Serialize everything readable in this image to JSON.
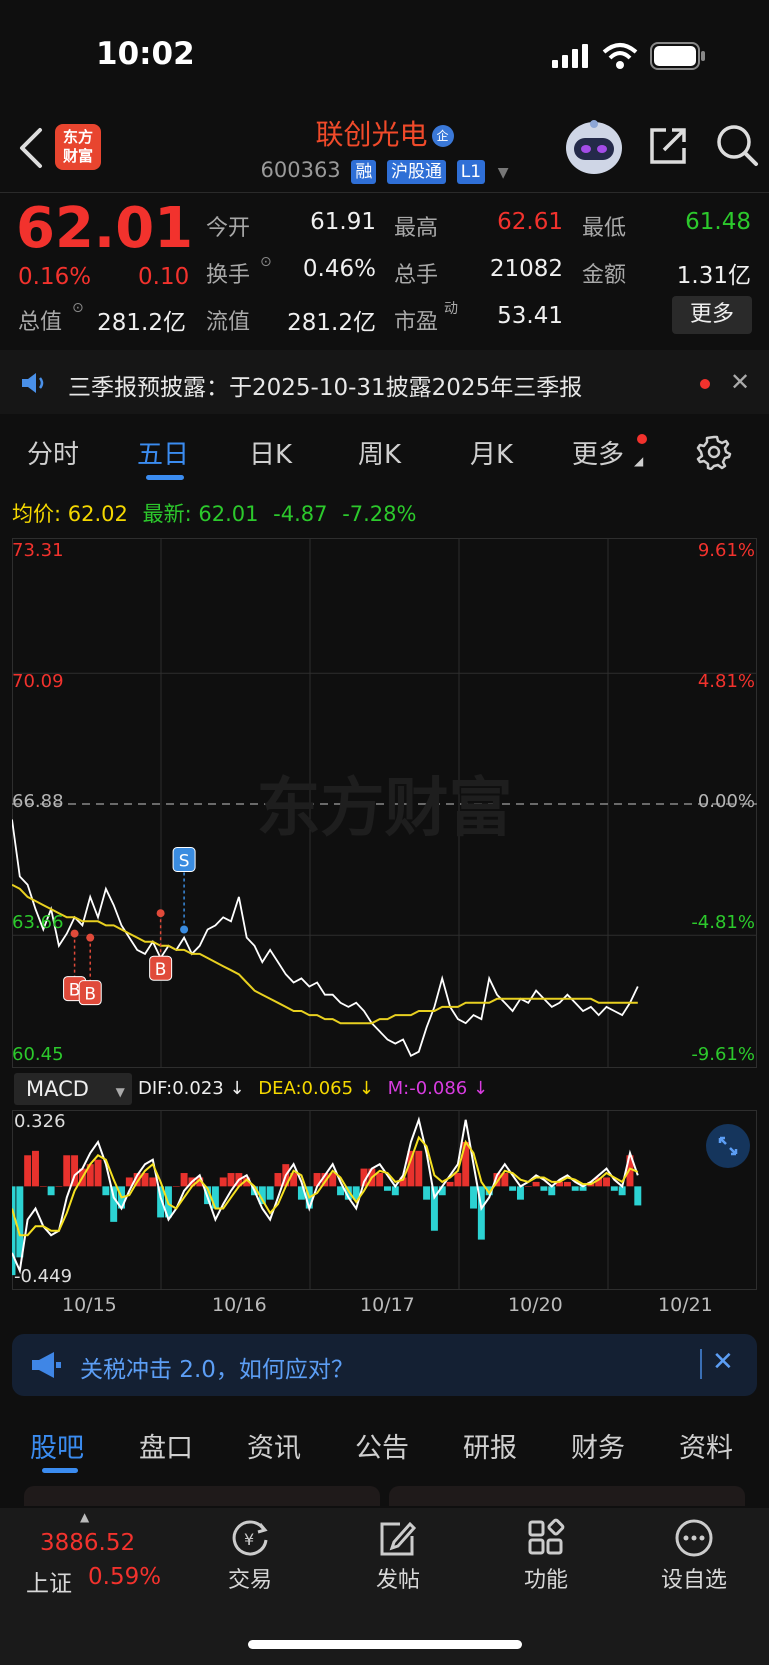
{
  "status_bar": {
    "time": "10:02"
  },
  "header": {
    "logo_line1": "东方",
    "logo_line2": "财富",
    "stock_name": "联创光电",
    "name_badge": "企",
    "stock_code": "600363",
    "tags": [
      "融",
      "沪股通",
      "L1"
    ]
  },
  "quote": {
    "price": "62.01",
    "change_pct": "0.16%",
    "change": "0.10",
    "fields": [
      {
        "label": "今开",
        "value": "61.91",
        "color": "white"
      },
      {
        "label": "最高",
        "value": "62.61",
        "color": "red"
      },
      {
        "label": "最低",
        "value": "61.48",
        "color": "green"
      },
      {
        "label": "换手",
        "value": "0.46%",
        "color": "white"
      },
      {
        "label": "总手",
        "value": "21082",
        "color": "white"
      },
      {
        "label": "金额",
        "value": "1.31亿",
        "color": "white"
      },
      {
        "label": "总值",
        "value": "281.2亿",
        "color": "white"
      },
      {
        "label": "流值",
        "value": "281.2亿",
        "color": "white"
      },
      {
        "label": "市盈",
        "value": "53.41",
        "color": "white"
      }
    ],
    "pe_superscript": "动",
    "more_label": "更多"
  },
  "notice": {
    "text": "三季报预披露：于2025-10-31披露2025年三季报"
  },
  "period_tabs": [
    "分时",
    "五日",
    "日K",
    "周K",
    "月K",
    "更多"
  ],
  "active_period_tab": "五日",
  "avg_row": {
    "avg_label": "均价:",
    "avg_value": "62.02",
    "latest_label": "最新:",
    "latest_value": "62.01",
    "latest_change": "-4.87",
    "latest_pct": "-7.28%"
  },
  "chart_data": {
    "type": "line",
    "y_ticks_left": [
      "73.31",
      "70.09",
      "66.88",
      "63.66",
      "60.45"
    ],
    "y_ticks_right": [
      "9.61%",
      "4.81%",
      "0.00%",
      "-4.81%",
      "-9.61%"
    ],
    "ylim": [
      60.45,
      73.31
    ],
    "reference_price": 66.88,
    "x_dates": [
      "10/15",
      "10/16",
      "10/17",
      "10/20",
      "10/21"
    ],
    "watermark": "东方财富",
    "series": [
      {
        "values": [
          66.5,
          65.1,
          64.9,
          64.3,
          63.8,
          64.3,
          63.4,
          63.7,
          64.1,
          63.9,
          64.6,
          64.1,
          64.8,
          64.4,
          63.9,
          63.6,
          63.3,
          63.2,
          63.5,
          63.1,
          63.4,
          63.3,
          63.6,
          63.2,
          63.4,
          63.8,
          63.9,
          64.1,
          64.0,
          64.6,
          63.6,
          63.4,
          63.0,
          63.3,
          63.0,
          62.7,
          62.5,
          62.6,
          62.4,
          62.5,
          62.2,
          62.2,
          62.0,
          61.9,
          62.0,
          61.8,
          61.5,
          61.3,
          61.1,
          61.0,
          61.1,
          60.7,
          60.8,
          61.4,
          61.9,
          62.6,
          61.9,
          61.6,
          61.5,
          61.7,
          61.6,
          62.6,
          62.2,
          62.0,
          61.8,
          62.1,
          62.0,
          62.3,
          62.1,
          61.9,
          62.0,
          62.2,
          62.0,
          61.8,
          61.9,
          61.7,
          61.9,
          61.8,
          61.7,
          62.0,
          62.4
        ]
      },
      {
        "values": [
          64.9,
          64.8,
          64.6,
          64.5,
          64.4,
          64.3,
          64.2,
          64.1,
          64.1,
          64.0,
          64.0,
          64.0,
          63.9,
          63.9,
          63.8,
          63.7,
          63.6,
          63.5,
          63.5,
          63.4,
          63.4,
          63.3,
          63.3,
          63.2,
          63.2,
          63.1,
          63.0,
          62.9,
          62.8,
          62.7,
          62.5,
          62.3,
          62.2,
          62.1,
          62.0,
          61.9,
          61.8,
          61.8,
          61.7,
          61.7,
          61.6,
          61.6,
          61.5,
          61.5,
          61.5,
          61.5,
          61.5,
          61.6,
          61.6,
          61.7,
          61.7,
          61.7,
          61.8,
          61.8,
          61.8,
          61.9,
          61.9,
          61.9,
          62.0,
          62.0,
          62.0,
          62.0,
          62.1,
          62.1,
          62.1,
          62.1,
          62.1,
          62.1,
          62.1,
          62.1,
          62.1,
          62.1,
          62.1,
          62.1,
          62.1,
          62.0,
          62.0,
          62.0,
          62.0,
          62.0,
          62.0
        ]
      }
    ],
    "markers": [
      {
        "label": "B",
        "index": 8,
        "price": 63.7
      },
      {
        "label": "B",
        "index": 10,
        "price": 63.6
      },
      {
        "label": "B",
        "index": 19,
        "price": 64.2
      },
      {
        "label": "S",
        "index": 22,
        "price": 63.8
      }
    ]
  },
  "macd": {
    "selector_label": "MACD",
    "dif_label": "DIF:0.023 ↓",
    "dea_label": "DEA:0.065 ↓",
    "m_label": "M:-0.086 ↓",
    "y_max_label": "0.326",
    "y_min_label": "-0.449",
    "ylim": [
      -0.449,
      0.326
    ],
    "dif": [
      -0.3,
      -0.38,
      -0.15,
      -0.1,
      -0.18,
      -0.22,
      -0.2,
      -0.05,
      0.05,
      0.08,
      0.15,
      0.2,
      0.1,
      -0.05,
      -0.1,
      -0.02,
      0.05,
      0.1,
      0.12,
      -0.05,
      -0.15,
      -0.1,
      -0.02,
      0.02,
      0.05,
      -0.05,
      -0.15,
      -0.08,
      -0.02,
      0.03,
      0.05,
      -0.02,
      -0.1,
      -0.15,
      -0.05,
      0.05,
      0.1,
      0.02,
      -0.1,
      0.0,
      0.05,
      0.1,
      0.02,
      -0.05,
      -0.1,
      0.02,
      0.08,
      0.1,
      0.05,
      0.0,
      0.05,
      0.2,
      0.3,
      0.15,
      -0.05,
      0.0,
      0.05,
      0.1,
      0.3,
      0.1,
      -0.1,
      -0.05,
      0.05,
      0.1,
      0.05,
      0.0,
      0.02,
      0.05,
      0.03,
      0.0,
      0.03,
      0.05,
      0.02,
      0.0,
      0.02,
      0.05,
      0.08,
      0.03,
      0.0,
      0.15,
      0.05
    ],
    "dea": [
      -0.1,
      -0.22,
      -0.22,
      -0.18,
      -0.18,
      -0.2,
      -0.2,
      -0.12,
      -0.02,
      0.04,
      0.1,
      0.14,
      0.12,
      0.03,
      -0.05,
      -0.04,
      0.02,
      0.07,
      0.1,
      0.02,
      -0.08,
      -0.1,
      -0.05,
      0.0,
      0.03,
      -0.01,
      -0.1,
      -0.1,
      -0.05,
      0.0,
      0.03,
      0.0,
      -0.06,
      -0.12,
      -0.08,
      0.0,
      0.07,
      0.05,
      -0.05,
      -0.03,
      0.02,
      0.07,
      0.04,
      -0.02,
      -0.07,
      -0.02,
      0.04,
      0.07,
      0.06,
      0.02,
      0.03,
      0.12,
      0.22,
      0.18,
      0.05,
      0.02,
      0.04,
      0.07,
      0.2,
      0.15,
      0.02,
      -0.03,
      0.02,
      0.07,
      0.06,
      0.03,
      0.02,
      0.04,
      0.04,
      0.02,
      0.02,
      0.04,
      0.03,
      0.01,
      0.01,
      0.03,
      0.06,
      0.04,
      0.02,
      0.08,
      0.065
    ],
    "m": [
      -0.4,
      -0.32,
      0.14,
      0.16,
      0.0,
      -0.04,
      0.0,
      0.14,
      0.14,
      0.08,
      0.1,
      0.12,
      -0.04,
      -0.16,
      -0.1,
      0.04,
      0.06,
      0.06,
      0.04,
      -0.14,
      -0.14,
      0.0,
      0.06,
      0.04,
      0.04,
      -0.08,
      -0.1,
      0.04,
      0.06,
      0.06,
      0.04,
      -0.04,
      -0.08,
      -0.06,
      0.06,
      0.1,
      0.06,
      -0.06,
      -0.1,
      0.06,
      0.06,
      0.06,
      -0.04,
      -0.06,
      -0.06,
      0.08,
      0.08,
      0.06,
      -0.02,
      -0.04,
      0.04,
      0.16,
      0.16,
      -0.06,
      -0.2,
      -0.04,
      0.02,
      0.06,
      0.2,
      -0.1,
      -0.24,
      -0.04,
      0.06,
      0.06,
      -0.02,
      -0.06,
      0.0,
      0.02,
      -0.02,
      -0.04,
      0.02,
      0.02,
      -0.02,
      -0.02,
      0.02,
      0.04,
      0.04,
      -0.02,
      -0.04,
      0.14,
      -0.086
    ]
  },
  "ad_banner": {
    "text": "关税冲击 2.0，如何应对？"
  },
  "bottom_tabs": [
    "股吧",
    "盘口",
    "资讯",
    "公告",
    "研报",
    "财务",
    "资料"
  ],
  "bottom_nav": {
    "index_value": "3886.52",
    "index_name": "上证",
    "index_pct": "0.59%",
    "items": [
      "交易",
      "发帖",
      "功能",
      "设自选"
    ]
  }
}
